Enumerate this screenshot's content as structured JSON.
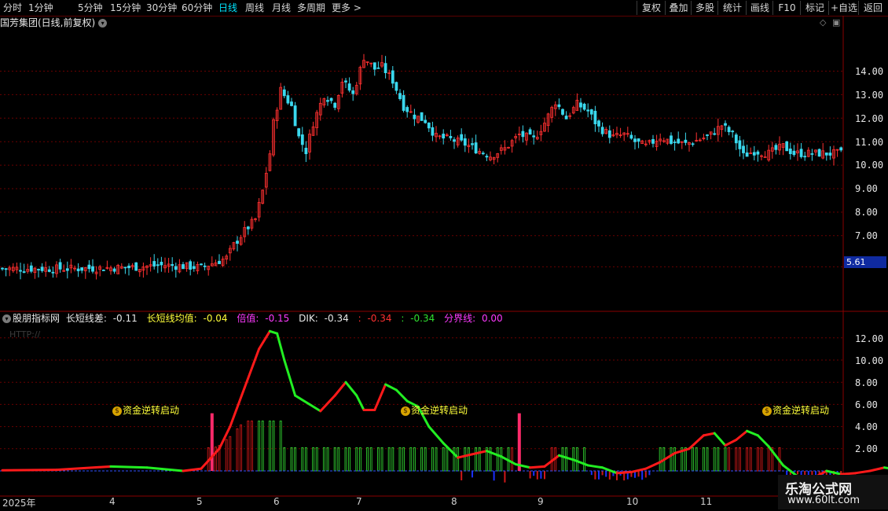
{
  "toolbar": {
    "periods": [
      "分时",
      "1分钟",
      "5分钟",
      "15分钟",
      "30分钟",
      "60分钟",
      "日线",
      "周线",
      "月线",
      "多周期",
      "更多 >"
    ],
    "active_period": "日线",
    "buttons": [
      "复权",
      "叠加",
      "多股",
      "统计",
      "画线",
      "F10",
      "标记",
      "+自选",
      "返回"
    ]
  },
  "main_title": "国芳集团(日线,前复权)",
  "price_axis": [
    "14.00",
    "13.00",
    "12.00",
    "11.00",
    "10.00",
    "9.00",
    "8.00",
    "7.00"
  ],
  "last_price_tag": "5.61",
  "indicator": {
    "name": "股朋指标网",
    "items": [
      {
        "label": "长短线差:",
        "value": "-0.11",
        "color": "#e8e8e8"
      },
      {
        "label": "长短线均值:",
        "value": "-0.04",
        "color": "#ffff3a"
      },
      {
        "label": "倍值:",
        "value": "-0.15",
        "color": "#ff3aff"
      },
      {
        "label": "DIK:",
        "value": "-0.34",
        "color": "#e8e8e8"
      },
      {
        "label": ":",
        "value": "-0.34",
        "color": "#ff3030"
      },
      {
        "label": ":",
        "value": "-0.34",
        "color": "#30e030"
      },
      {
        "label": "分界线:",
        "value": "0.00",
        "color": "#ff3aff"
      }
    ],
    "watermark_text": "HTTP://",
    "signal_text": "资金逆转启动"
  },
  "indicator_axis": [
    "12.00",
    "10.00",
    "8.00",
    "6.00",
    "4.00",
    "2.00"
  ],
  "date_axis": [
    "2025年",
    "4",
    "5",
    "6",
    "7",
    "8",
    "9",
    "10",
    "11"
  ],
  "brand": {
    "title": "乐淘公式网",
    "url": "www.60lt.com"
  },
  "colors": {
    "up": "#ff3030",
    "down": "#3ad8ee",
    "grid": "#6a0000",
    "line_up": "#ff1a1a",
    "line_down": "#22ee22",
    "hist_pos_red": "#d01818",
    "hist_pos_green": "#30d030",
    "hist_neg": "#1a30ff"
  },
  "chart_data": [
    {
      "type": "candlestick",
      "title": "国芳集团(日线,前复权)",
      "y_ticks": [
        14,
        13,
        12,
        11,
        10,
        9,
        8,
        7
      ],
      "last_price": 5.61,
      "close_path": [
        [
          0,
          5.6
        ],
        [
          20,
          5.6
        ],
        [
          35,
          5.65
        ],
        [
          45,
          5.75
        ],
        [
          55,
          5.65
        ],
        [
          62,
          6.05
        ],
        [
          64,
          6.6
        ],
        [
          67,
          7.2
        ],
        [
          70,
          7.7
        ],
        [
          72,
          8.9
        ],
        [
          74,
          10.5
        ],
        [
          75,
          11.8
        ],
        [
          77,
          13.2
        ],
        [
          80,
          12.5
        ],
        [
          82,
          11.2
        ],
        [
          84,
          10.6
        ],
        [
          86,
          11.8
        ],
        [
          89,
          13.0
        ],
        [
          92,
          12.6
        ],
        [
          94,
          13.6
        ],
        [
          97,
          13.0
        ],
        [
          100,
          14.6
        ],
        [
          103,
          14.1
        ],
        [
          105,
          14.2
        ],
        [
          108,
          13.6
        ],
        [
          111,
          12.5
        ],
        [
          114,
          12.1
        ],
        [
          117,
          11.9
        ],
        [
          120,
          11.2
        ],
        [
          124,
          11.1
        ],
        [
          128,
          10.9
        ],
        [
          132,
          10.6
        ],
        [
          135,
          10.4
        ],
        [
          139,
          10.7
        ],
        [
          143,
          11.3
        ],
        [
          147,
          11.1
        ],
        [
          150,
          11.8
        ],
        [
          153,
          12.7
        ],
        [
          156,
          12.0
        ],
        [
          159,
          12.6
        ],
        [
          162,
          12.3
        ],
        [
          165,
          11.6
        ],
        [
          169,
          11.2
        ],
        [
          172,
          11.3
        ],
        [
          175,
          11.0
        ],
        [
          178,
          10.8
        ],
        [
          182,
          11.2
        ],
        [
          185,
          11.0
        ],
        [
          189,
          10.9
        ],
        [
          193,
          11.1
        ],
        [
          196,
          11.3
        ],
        [
          199,
          11.7
        ],
        [
          202,
          11.3
        ],
        [
          205,
          10.4
        ],
        [
          208,
          10.6
        ],
        [
          212,
          10.5
        ],
        [
          216,
          10.8
        ],
        [
          219,
          10.5
        ]
      ]
    },
    {
      "type": "line+bar",
      "title": "股朋指标网",
      "y_ticks": [
        12,
        10,
        8,
        6,
        4,
        2
      ],
      "line": [
        [
          0,
          0.05
        ],
        [
          15,
          0.1
        ],
        [
          30,
          0.4
        ],
        [
          40,
          0.3
        ],
        [
          50,
          0.0
        ],
        [
          55,
          0.2
        ],
        [
          60,
          2.0
        ],
        [
          63,
          4.0
        ],
        [
          67,
          7.5
        ],
        [
          71,
          11.0
        ],
        [
          74,
          12.6
        ],
        [
          76,
          12.4
        ],
        [
          78,
          10.0
        ],
        [
          81,
          6.8
        ],
        [
          85,
          6.0
        ],
        [
          88,
          5.4
        ],
        [
          92,
          6.8
        ],
        [
          95,
          8.0
        ],
        [
          98,
          6.8
        ],
        [
          100,
          5.5
        ],
        [
          103,
          5.5
        ],
        [
          106,
          7.8
        ],
        [
          109,
          7.3
        ],
        [
          112,
          6.3
        ],
        [
          115,
          5.8
        ],
        [
          118,
          4.0
        ],
        [
          122,
          2.5
        ],
        [
          126,
          1.2
        ],
        [
          130,
          1.5
        ],
        [
          134,
          1.8
        ],
        [
          138,
          1.3
        ],
        [
          142,
          0.6
        ],
        [
          146,
          0.3
        ],
        [
          150,
          0.4
        ],
        [
          154,
          1.4
        ],
        [
          158,
          1.0
        ],
        [
          162,
          0.5
        ],
        [
          166,
          0.3
        ],
        [
          170,
          -0.2
        ],
        [
          174,
          -0.1
        ],
        [
          178,
          0.2
        ],
        [
          182,
          0.8
        ],
        [
          186,
          1.6
        ],
        [
          190,
          2.0
        ],
        [
          194,
          3.2
        ],
        [
          197,
          3.4
        ],
        [
          200,
          2.3
        ],
        [
          203,
          2.8
        ],
        [
          206,
          3.6
        ],
        [
          209,
          3.2
        ],
        [
          212,
          2.2
        ],
        [
          216,
          0.5
        ],
        [
          220,
          -0.5
        ],
        [
          224,
          -0.7
        ],
        [
          228,
          0.0
        ],
        [
          232,
          -0.3
        ],
        [
          236,
          -0.2
        ],
        [
          240,
          0.0
        ],
        [
          244,
          0.3
        ],
        [
          248,
          0.1
        ],
        [
          252,
          0.8
        ],
        [
          256,
          1.5
        ],
        [
          260,
          0.8
        ],
        [
          264,
          -0.7
        ],
        [
          266,
          -0.9
        ]
      ],
      "signal_days": [
        58,
        143,
        260
      ]
    }
  ]
}
